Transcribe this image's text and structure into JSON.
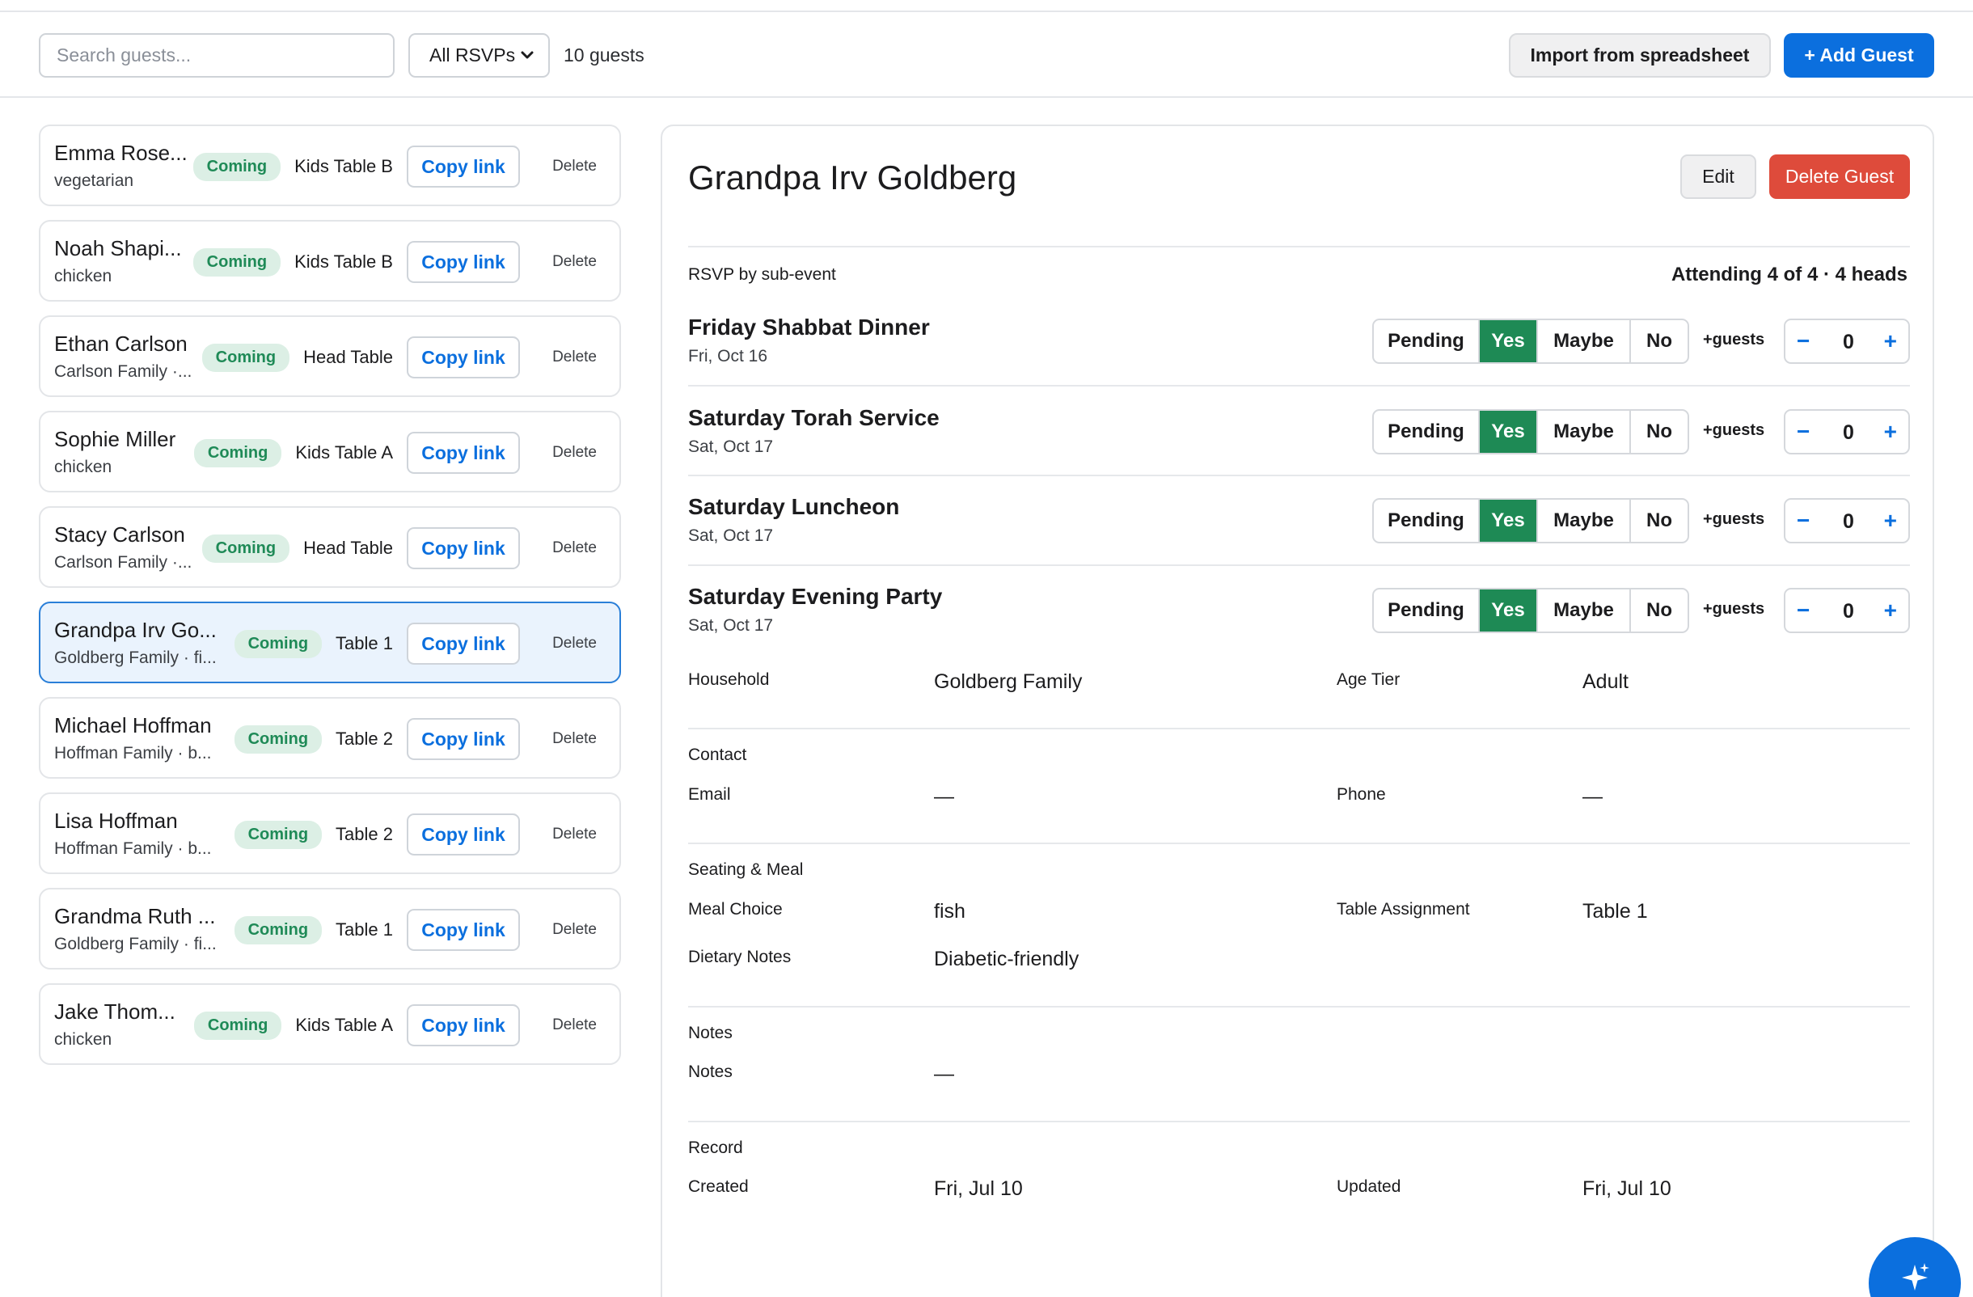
{
  "toolbar": {
    "search_placeholder": "Search guests...",
    "rsvp_filter": "All RSVPs",
    "guest_count": "10 guests",
    "import_label": "Import from spreadsheet",
    "add_label": "+ Add Guest"
  },
  "guests": [
    {
      "name": "Emma Rose...",
      "sub": "vegetarian",
      "status": "Coming",
      "table": "Kids Table B",
      "copy": "Copy link",
      "delete": "Delete"
    },
    {
      "name": "Noah Shapi...",
      "sub": "chicken",
      "status": "Coming",
      "table": "Kids Table B",
      "copy": "Copy link",
      "delete": "Delete"
    },
    {
      "name": "Ethan Carlson",
      "sub": "Carlson Family ·...",
      "status": "Coming",
      "table": "Head Table",
      "copy": "Copy link",
      "delete": "Delete"
    },
    {
      "name": "Sophie Miller",
      "sub": "chicken",
      "status": "Coming",
      "table": "Kids Table A",
      "copy": "Copy link",
      "delete": "Delete"
    },
    {
      "name": "Stacy Carlson",
      "sub": "Carlson Family ·...",
      "status": "Coming",
      "table": "Head Table",
      "copy": "Copy link",
      "delete": "Delete"
    },
    {
      "name": "Grandpa Irv Go...",
      "sub": "Goldberg Family · fi...",
      "status": "Coming",
      "table": "Table 1",
      "copy": "Copy link",
      "delete": "Delete",
      "selected": true
    },
    {
      "name": "Michael Hoffman",
      "sub": "Hoffman Family · b...",
      "status": "Coming",
      "table": "Table 2",
      "copy": "Copy link",
      "delete": "Delete"
    },
    {
      "name": "Lisa Hoffman",
      "sub": "Hoffman Family · b...",
      "status": "Coming",
      "table": "Table 2",
      "copy": "Copy link",
      "delete": "Delete"
    },
    {
      "name": "Grandma Ruth ...",
      "sub": "Goldberg Family · fi...",
      "status": "Coming",
      "table": "Table 1",
      "copy": "Copy link",
      "delete": "Delete"
    },
    {
      "name": "Jake Thom...",
      "sub": "chicken",
      "status": "Coming",
      "table": "Kids Table A",
      "copy": "Copy link",
      "delete": "Delete"
    }
  ],
  "detail": {
    "title": "Grandpa Irv Goldberg",
    "edit_label": "Edit",
    "delete_label": "Delete Guest",
    "rsvp_label": "RSVP by sub-event",
    "attending": "Attending 4 of 4 · 4 heads",
    "rsvp_options": [
      "Pending",
      "Yes",
      "Maybe",
      "No"
    ],
    "plus_guests_label": "+guests",
    "subevents": [
      {
        "name": "Friday Shabbat Dinner",
        "date": "Fri, Oct 16",
        "selected": "Yes",
        "plus": "0"
      },
      {
        "name": "Saturday Torah Service",
        "date": "Sat, Oct 17",
        "selected": "Yes",
        "plus": "0"
      },
      {
        "name": "Saturday Luncheon",
        "date": "Sat, Oct 17",
        "selected": "Yes",
        "plus": "0"
      },
      {
        "name": "Saturday Evening Party",
        "date": "Sat, Oct 17",
        "selected": "Yes",
        "plus": "0"
      }
    ],
    "household_label": "Household",
    "household": "Goldberg Family",
    "age_tier_label": "Age Tier",
    "age_tier": "Adult",
    "contact_heading": "Contact",
    "email_label": "Email",
    "email": "—",
    "phone_label": "Phone",
    "phone": "—",
    "seating_heading": "Seating & Meal",
    "meal_label": "Meal Choice",
    "meal": "fish",
    "table_label": "Table Assignment",
    "table": "Table 1",
    "dietary_label": "Dietary Notes",
    "dietary": "Diabetic-friendly",
    "notes_heading": "Notes",
    "notes_label": "Notes",
    "notes": "—",
    "record_heading": "Record",
    "created_label": "Created",
    "created": "Fri, Jul 10",
    "updated_label": "Updated",
    "updated": "Fri, Jul 10"
  },
  "colors": {
    "accent": "#0b6fde",
    "danger": "#de4b3b",
    "yes_green": "#1e8a55",
    "badge_bg": "#dcefe5",
    "badge_text": "#1f8a57",
    "selected_bg": "#eaf3fd"
  },
  "icons": {
    "filter_chevron": "chevron-down-icon",
    "fab": "sparkle-icon"
  }
}
